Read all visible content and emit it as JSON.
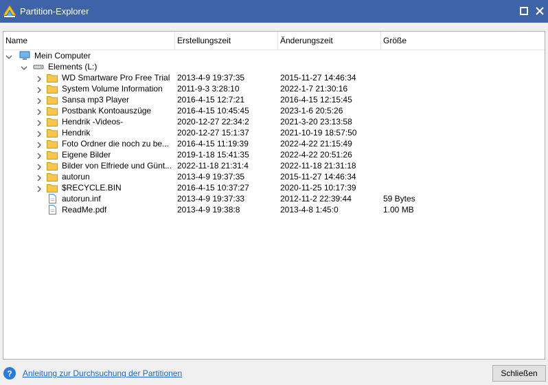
{
  "window": {
    "title": "Partition-Explorer",
    "icons": [
      "app-icon",
      "maximize-icon",
      "close-icon"
    ]
  },
  "columns": [
    "Name",
    "Erstellungszeit",
    "Änderungszeit",
    "Größe"
  ],
  "tree": [
    {
      "name": "Mein Computer",
      "created": "",
      "modified": "",
      "size": "",
      "type": "computer",
      "level": 0,
      "expanded": true
    },
    {
      "name": "Elements (L:)",
      "created": "",
      "modified": "",
      "size": "",
      "type": "drive",
      "level": 1,
      "expanded": true
    },
    {
      "name": "WD Smartware Pro Free Trial",
      "created": "2013-4-9 19:37:35",
      "modified": "2015-11-27 14:46:34",
      "size": "",
      "type": "folder",
      "level": 2,
      "expanded": false
    },
    {
      "name": "System Volume Information",
      "created": "2011-9-3 3:28:10",
      "modified": "2022-1-7 21:30:16",
      "size": "",
      "type": "folder",
      "level": 2,
      "expanded": false
    },
    {
      "name": "Sansa mp3 Player",
      "created": "2016-4-15 12:7:21",
      "modified": "2016-4-15 12:15:45",
      "size": "",
      "type": "folder",
      "level": 2,
      "expanded": false
    },
    {
      "name": "Postbank Kontoauszüge",
      "created": "2016-4-15 10:45:45",
      "modified": "2023-1-6 20:5:26",
      "size": "",
      "type": "folder",
      "level": 2,
      "expanded": false
    },
    {
      "name": "Hendrik -Videos-",
      "created": "2020-12-27 22:34:2",
      "modified": "2021-3-20 23:13:58",
      "size": "",
      "type": "folder",
      "level": 2,
      "expanded": false
    },
    {
      "name": "Hendrik",
      "created": "2020-12-27 15:1:37",
      "modified": "2021-10-19 18:57:50",
      "size": "",
      "type": "folder",
      "level": 2,
      "expanded": false
    },
    {
      "name": "Foto Ordner  die noch zu be...",
      "created": "2016-4-15 11:19:39",
      "modified": "2022-4-22 21:15:49",
      "size": "",
      "type": "folder",
      "level": 2,
      "expanded": false
    },
    {
      "name": "Eigene Bilder",
      "created": "2019-1-18 15:41:35",
      "modified": "2022-4-22 20:51:26",
      "size": "",
      "type": "folder",
      "level": 2,
      "expanded": false
    },
    {
      "name": "Bilder von Elfriede und Günt...",
      "created": "2022-11-18 21:31:4",
      "modified": "2022-11-18 21:31:18",
      "size": "",
      "type": "folder",
      "level": 2,
      "expanded": false
    },
    {
      "name": "autorun",
      "created": "2013-4-9 19:37:35",
      "modified": "2015-11-27 14:46:34",
      "size": "",
      "type": "folder",
      "level": 2,
      "expanded": false
    },
    {
      "name": "$RECYCLE.BIN",
      "created": "2016-4-15 10:37:27",
      "modified": "2020-11-25 10:17:39",
      "size": "",
      "type": "folder",
      "level": 2,
      "expanded": false
    },
    {
      "name": "autorun.inf",
      "created": "2013-4-9 19:37:33",
      "modified": "2012-11-2 22:39:44",
      "size": "59 Bytes",
      "type": "file",
      "level": 2
    },
    {
      "name": "ReadMe.pdf",
      "created": "2013-4-9 19:38:8",
      "modified": "2013-4-8 1:45:0",
      "size": "1.00 MB",
      "type": "file",
      "level": 2
    }
  ],
  "footer": {
    "help_link": "Anleitung zur Durchsuchung der Partitionen",
    "close_label": "Schließen"
  },
  "colors": {
    "titlebar": "#3e63a7",
    "folder": "#f8c84a",
    "link": "#1f67c3",
    "help_icon": "#2b7bd9"
  }
}
